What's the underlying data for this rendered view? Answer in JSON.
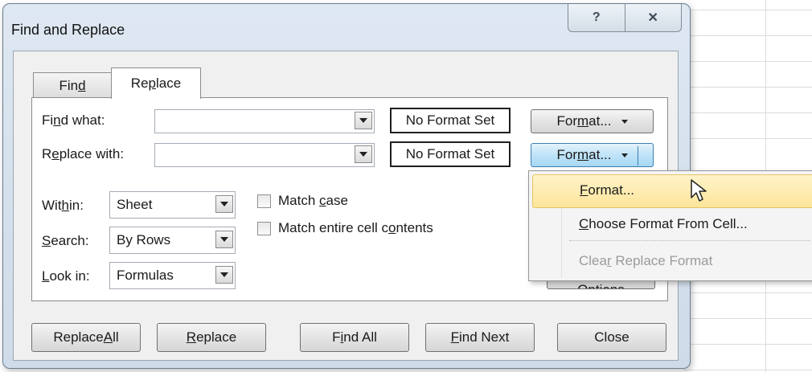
{
  "dialog": {
    "title": "Find and Replace",
    "help_icon": "?",
    "close_icon": "✕"
  },
  "tabs": {
    "find": {
      "pre": "Fin",
      "key": "d",
      "post": ""
    },
    "replace": {
      "pre": "Re",
      "key": "p",
      "post": "lace"
    }
  },
  "fields": {
    "find_what": {
      "pre": "Fi",
      "key": "n",
      "post": "d what:",
      "value": "",
      "format": "No Format Set"
    },
    "replace_with": {
      "pre": "R",
      "key": "e",
      "post": "place with:",
      "value": "",
      "format": "No Format Set"
    }
  },
  "options": {
    "within": {
      "pre": "Wit",
      "key": "h",
      "post": "in:",
      "value": "Sheet"
    },
    "search": {
      "pre": "",
      "key": "S",
      "post": "earch:",
      "value": "By Rows"
    },
    "look_in": {
      "pre": "",
      "key": "L",
      "post": "ook in:",
      "value": "Formulas"
    },
    "match_case": {
      "pre": "Match ",
      "key": "c",
      "post": "ase",
      "checked": false
    },
    "match_entire": {
      "pre": "Match entire cell c",
      "key": "o",
      "post": "ntents",
      "checked": false
    }
  },
  "format_buttons": {
    "find": {
      "pre": "For",
      "key": "m",
      "post": "at..."
    },
    "replace": {
      "pre": "For",
      "key": "m",
      "post": "at..."
    }
  },
  "options_button_partial": "Options",
  "menu": {
    "items": [
      {
        "pre": "",
        "key": "F",
        "post": "ormat...",
        "state": "highlighted"
      },
      {
        "pre": "",
        "key": "C",
        "post": "hoose Format From Cell...",
        "state": "normal"
      },
      {
        "pre": "Clea",
        "key": "r",
        "post": " Replace Format",
        "state": "disabled"
      }
    ]
  },
  "buttons": {
    "replace_all": {
      "pre": "Replace ",
      "key": "A",
      "post": "ll"
    },
    "replace": {
      "pre": "",
      "key": "R",
      "post": "eplace"
    },
    "find_all": {
      "pre": "F",
      "key": "i",
      "post": "nd All"
    },
    "find_next": {
      "pre": "",
      "key": "F",
      "post": "ind Next"
    },
    "close": {
      "pre": "Close",
      "key": "",
      "post": ""
    }
  }
}
